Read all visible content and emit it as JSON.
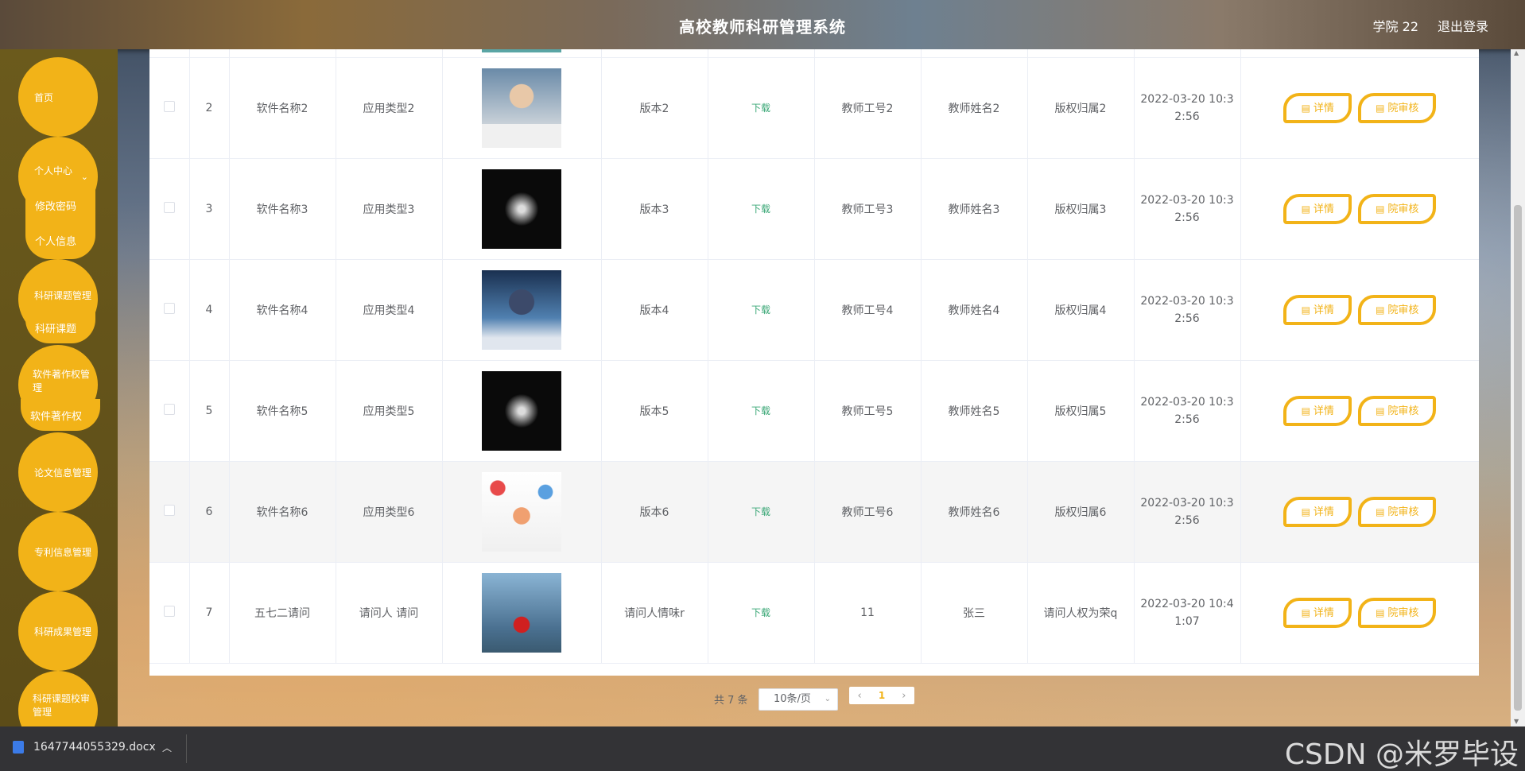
{
  "header": {
    "title": "高校教师科研管理系统",
    "user": "学院 22",
    "logout": "退出登录"
  },
  "sidebar": {
    "home": "首页",
    "personal_center": "个人中心",
    "change_password": "修改密码",
    "personal_info": "个人信息",
    "research_topic_mgmt": "科研课题管理",
    "research_topic": "科研课题",
    "software_copyright_mgmt": "软件著作权管理",
    "software_copyright": "软件著作权",
    "paper_info_mgmt": "论文信息管理",
    "patent_info_mgmt": "专利信息管理",
    "research_result_mgmt": "科研成果管理",
    "topic_review_mgmt": "科研课题校审管理"
  },
  "table": {
    "download_label": "下载",
    "detail_label": "详情",
    "review_label": "院审核",
    "rows": [
      {
        "index": "2",
        "name": "软件名称2",
        "app_type": "应用类型2",
        "version": "版本2",
        "teacher_no": "教师工号2",
        "teacher_name": "教师姓名2",
        "ownership": "版权归属2",
        "time_line1": "2022-03-20 10:3",
        "time_line2": "2:56"
      },
      {
        "index": "3",
        "name": "软件名称3",
        "app_type": "应用类型3",
        "version": "版本3",
        "teacher_no": "教师工号3",
        "teacher_name": "教师姓名3",
        "ownership": "版权归属3",
        "time_line1": "2022-03-20 10:3",
        "time_line2": "2:56"
      },
      {
        "index": "4",
        "name": "软件名称4",
        "app_type": "应用类型4",
        "version": "版本4",
        "teacher_no": "教师工号4",
        "teacher_name": "教师姓名4",
        "ownership": "版权归属4",
        "time_line1": "2022-03-20 10:3",
        "time_line2": "2:56"
      },
      {
        "index": "5",
        "name": "软件名称5",
        "app_type": "应用类型5",
        "version": "版本5",
        "teacher_no": "教师工号5",
        "teacher_name": "教师姓名5",
        "ownership": "版权归属5",
        "time_line1": "2022-03-20 10:3",
        "time_line2": "2:56"
      },
      {
        "index": "6",
        "name": "软件名称6",
        "app_type": "应用类型6",
        "version": "版本6",
        "teacher_no": "教师工号6",
        "teacher_name": "教师姓名6",
        "ownership": "版权归属6",
        "time_line1": "2022-03-20 10:3",
        "time_line2": "2:56"
      },
      {
        "index": "7",
        "name": "五七二请问",
        "app_type": "请问人 请问",
        "version": "请问人情味r",
        "teacher_no": "11",
        "teacher_name": "张三",
        "ownership": "请问人权为荣q",
        "time_line1": "2022-03-20 10:4",
        "time_line2": "1:07"
      }
    ]
  },
  "pagination": {
    "total": "共 7 条",
    "page_size": "10条/页",
    "current_page": "1",
    "prev": "‹",
    "next": "›"
  },
  "download_bar": {
    "file_name": "1647744055329.docx",
    "watermark": "CSDN @米罗毕设"
  },
  "colors": {
    "accent": "#f2b318",
    "download_link": "#3aa776"
  }
}
